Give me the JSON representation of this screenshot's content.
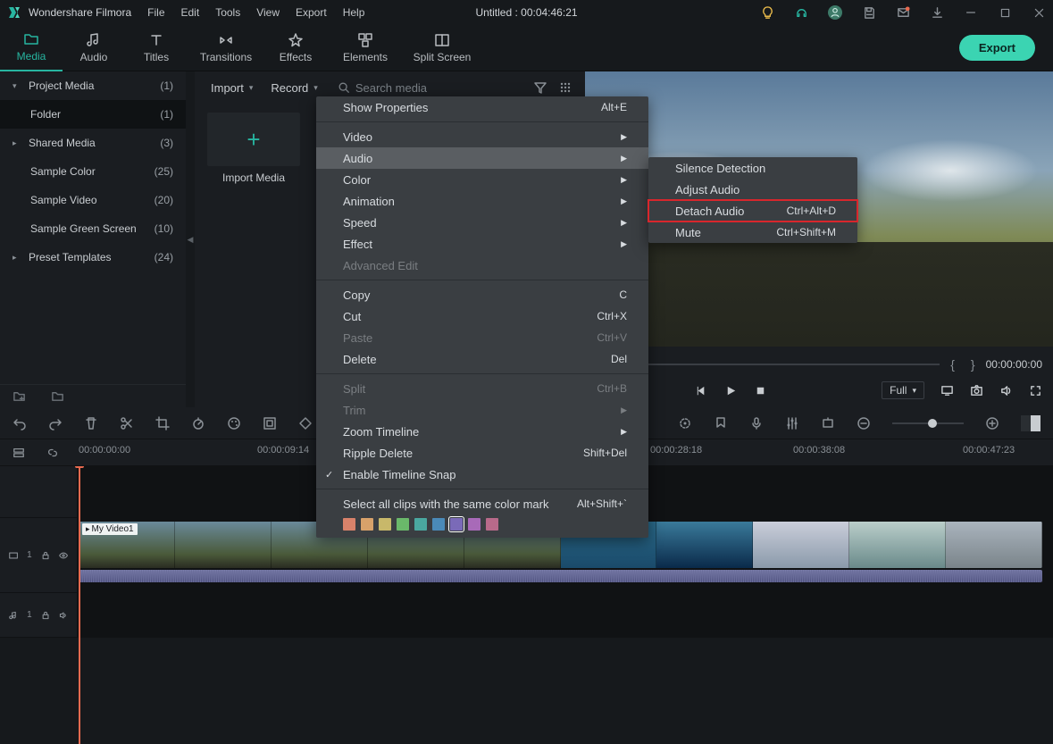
{
  "app_name": "Wondershare Filmora",
  "center_title": "Untitled : 00:04:46:21",
  "menus": [
    "File",
    "Edit",
    "Tools",
    "View",
    "Export",
    "Help"
  ],
  "tabs": [
    {
      "label": "Media"
    },
    {
      "label": "Audio"
    },
    {
      "label": "Titles"
    },
    {
      "label": "Transitions"
    },
    {
      "label": "Effects"
    },
    {
      "label": "Elements"
    },
    {
      "label": "Split Screen"
    }
  ],
  "export_label": "Export",
  "sidebar": [
    {
      "label": "Project Media",
      "count": "(1)",
      "arrow": "▾",
      "head": true
    },
    {
      "label": "Folder",
      "count": "(1)",
      "sel": true,
      "indent": true
    },
    {
      "label": "Shared Media",
      "count": "(3)",
      "arrow": "▸",
      "head": true
    },
    {
      "label": "Sample Color",
      "count": "(25)",
      "indent": true
    },
    {
      "label": "Sample Video",
      "count": "(20)",
      "indent": true
    },
    {
      "label": "Sample Green Screen",
      "count": "(10)",
      "indent": true
    },
    {
      "label": "Preset Templates",
      "count": "(24)",
      "arrow": "▸",
      "head": true
    }
  ],
  "mid": {
    "import": "Import",
    "record": "Record",
    "search_placeholder": "Search media",
    "card_label": "Import Media"
  },
  "player": {
    "brace_l": "{",
    "brace_r": "}",
    "time_right": "00:00:00:00",
    "full": "Full"
  },
  "ruler": [
    "00:00:00:00",
    "00:00:09:14",
    "00:00:28:18",
    "00:00:38:08",
    "00:00:47:23"
  ],
  "clip_label": "My Video1",
  "track1": "1",
  "track2": "1",
  "ctx_main": [
    {
      "t": "item",
      "label": "Show Properties",
      "sc": "Alt+E"
    },
    {
      "t": "sep"
    },
    {
      "t": "item",
      "label": "Video",
      "ar": true
    },
    {
      "t": "item",
      "label": "Audio",
      "ar": true,
      "hl": true
    },
    {
      "t": "item",
      "label": "Color",
      "ar": true
    },
    {
      "t": "item",
      "label": "Animation",
      "ar": true
    },
    {
      "t": "item",
      "label": "Speed",
      "ar": true
    },
    {
      "t": "item",
      "label": "Effect",
      "ar": true
    },
    {
      "t": "item",
      "label": "Advanced Edit",
      "dis": true
    },
    {
      "t": "sep"
    },
    {
      "t": "item",
      "label": "Copy",
      "sc": "C"
    },
    {
      "t": "item",
      "label": "Cut",
      "sc": "Ctrl+X"
    },
    {
      "t": "item",
      "label": "Paste",
      "sc": "Ctrl+V",
      "dis": true
    },
    {
      "t": "item",
      "label": "Delete",
      "sc": "Del"
    },
    {
      "t": "sep"
    },
    {
      "t": "item",
      "label": "Split",
      "sc": "Ctrl+B",
      "dis": true
    },
    {
      "t": "item",
      "label": "Trim",
      "ar": true,
      "dis": true
    },
    {
      "t": "item",
      "label": "Zoom Timeline",
      "ar": true
    },
    {
      "t": "item",
      "label": "Ripple Delete",
      "sc": "Shift+Del"
    },
    {
      "t": "item",
      "label": "Enable Timeline Snap",
      "chk": true
    },
    {
      "t": "sep"
    },
    {
      "t": "item",
      "label": "Select all clips with the same color mark",
      "sc": "Alt+Shift+`"
    },
    {
      "t": "swatches",
      "colors": [
        "#d8826a",
        "#d8a26a",
        "#c8b86a",
        "#6ab86a",
        "#4aa8a0",
        "#4a8ab8",
        "#7a6ab8",
        "#a86ab8",
        "#b86a8a"
      ],
      "sel": 6
    }
  ],
  "ctx_sub": [
    {
      "label": "Silence Detection"
    },
    {
      "label": "Adjust Audio"
    },
    {
      "label": "Detach Audio",
      "sc": "Ctrl+Alt+D",
      "hilite": true
    },
    {
      "label": "Mute",
      "sc": "Ctrl+Shift+M"
    }
  ]
}
